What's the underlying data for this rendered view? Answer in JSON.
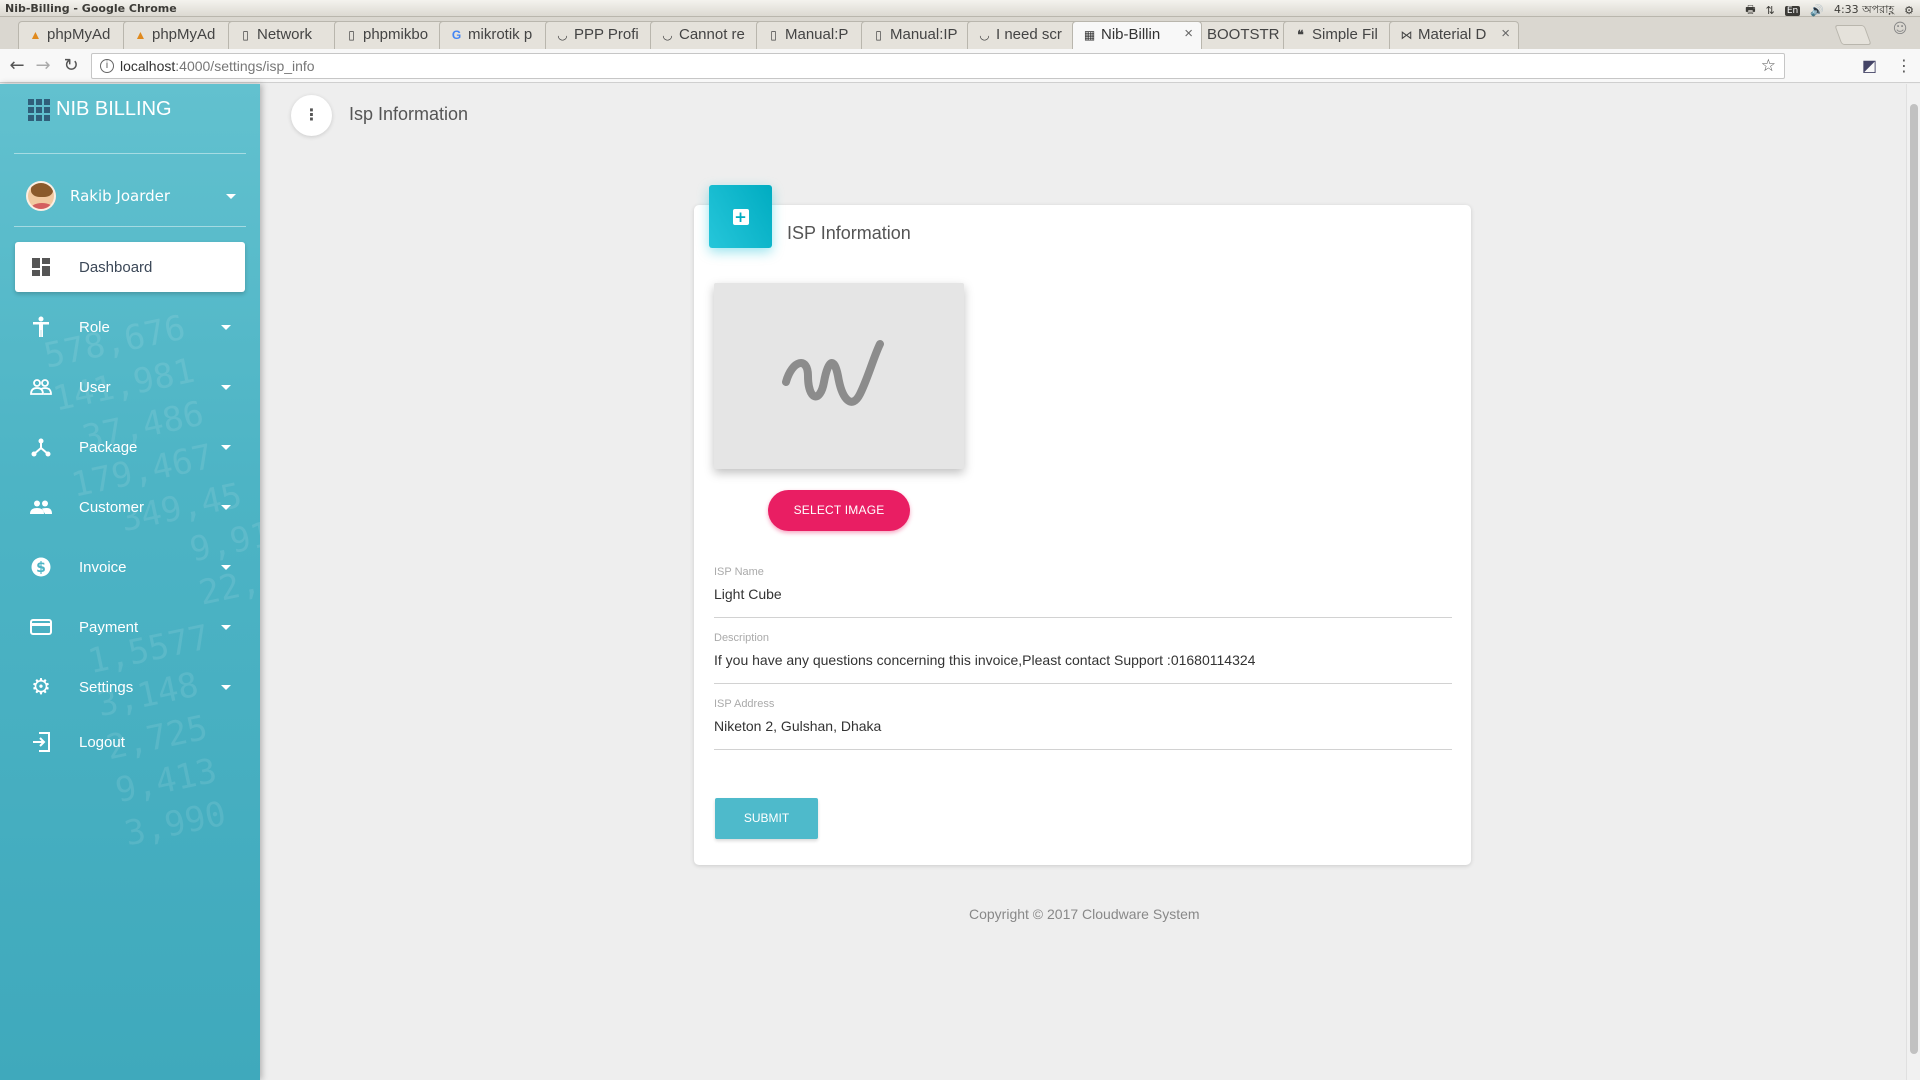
{
  "os": {
    "window_title": "Nib-Billing - Google Chrome",
    "time": "4:33 অপরাহ্ণ",
    "keyboard": "En"
  },
  "tabs": [
    {
      "label": "phpMyAd",
      "icon": "pma-icon"
    },
    {
      "label": "phpMyAd",
      "icon": "pma-icon"
    },
    {
      "label": "Network",
      "icon": "page-icon"
    },
    {
      "label": "phpmikbo",
      "icon": "page-icon"
    },
    {
      "label": "mikrotik p",
      "icon": "google-icon"
    },
    {
      "label": "PPP Profi",
      "icon": "mikrotik-icon"
    },
    {
      "label": "Cannot re",
      "icon": "mikrotik-icon"
    },
    {
      "label": "Manual:P",
      "icon": "page-icon"
    },
    {
      "label": "Manual:IP",
      "icon": "page-icon"
    },
    {
      "label": "I need scr",
      "icon": "mikrotik-icon"
    },
    {
      "label": "Nib-Billin",
      "icon": "grid-icon",
      "active": true
    },
    {
      "label": "BOOTSTR",
      "icon": "google-icon"
    },
    {
      "label": "Simple Fil",
      "icon": "quote-icon"
    },
    {
      "label": "Material D",
      "icon": "bowtie-icon"
    }
  ],
  "address": {
    "host": "localhost",
    "path": ":4000/settings/isp_info"
  },
  "sidebar": {
    "brand": "NIB BILLING",
    "user_name": "Rakib Joarder",
    "items": [
      {
        "label": "Dashboard",
        "icon": "dashboard-icon",
        "active": true,
        "has_caret": false
      },
      {
        "label": "Role",
        "icon": "person-icon",
        "has_caret": true
      },
      {
        "label": "User",
        "icon": "users-icon",
        "has_caret": true
      },
      {
        "label": "Package",
        "icon": "network-icon",
        "has_caret": true
      },
      {
        "label": "Customer",
        "icon": "group-icon",
        "has_caret": true
      },
      {
        "label": "Invoice",
        "icon": "dollar-icon",
        "has_caret": true
      },
      {
        "label": "Payment",
        "icon": "credit-card-icon",
        "has_caret": true
      },
      {
        "label": "Settings",
        "icon": "gear-icon",
        "has_caret": true
      },
      {
        "label": "Logout",
        "icon": "logout-icon",
        "has_caret": false
      }
    ]
  },
  "page": {
    "title": "Isp Information"
  },
  "card": {
    "title": "ISP Information",
    "select_image_label": "SELECT IMAGE",
    "fields": [
      {
        "label": "ISP Name",
        "value": "Light Cube"
      },
      {
        "label": "Description",
        "value": "If you have any questions concerning this invoice,Pleast contact Support :01680114324"
      },
      {
        "label": "ISP Address",
        "value": "Niketon 2, Gulshan, Dhaka"
      }
    ],
    "submit_label": "SUBMIT"
  },
  "footer": {
    "copyright": "Copyright © 2017 Cloudware System"
  },
  "colors": {
    "sidebar": "#4db4c5",
    "accent_pink": "#e91e63",
    "accent_cyan": "#00acc1",
    "submit": "#4ebacb"
  }
}
